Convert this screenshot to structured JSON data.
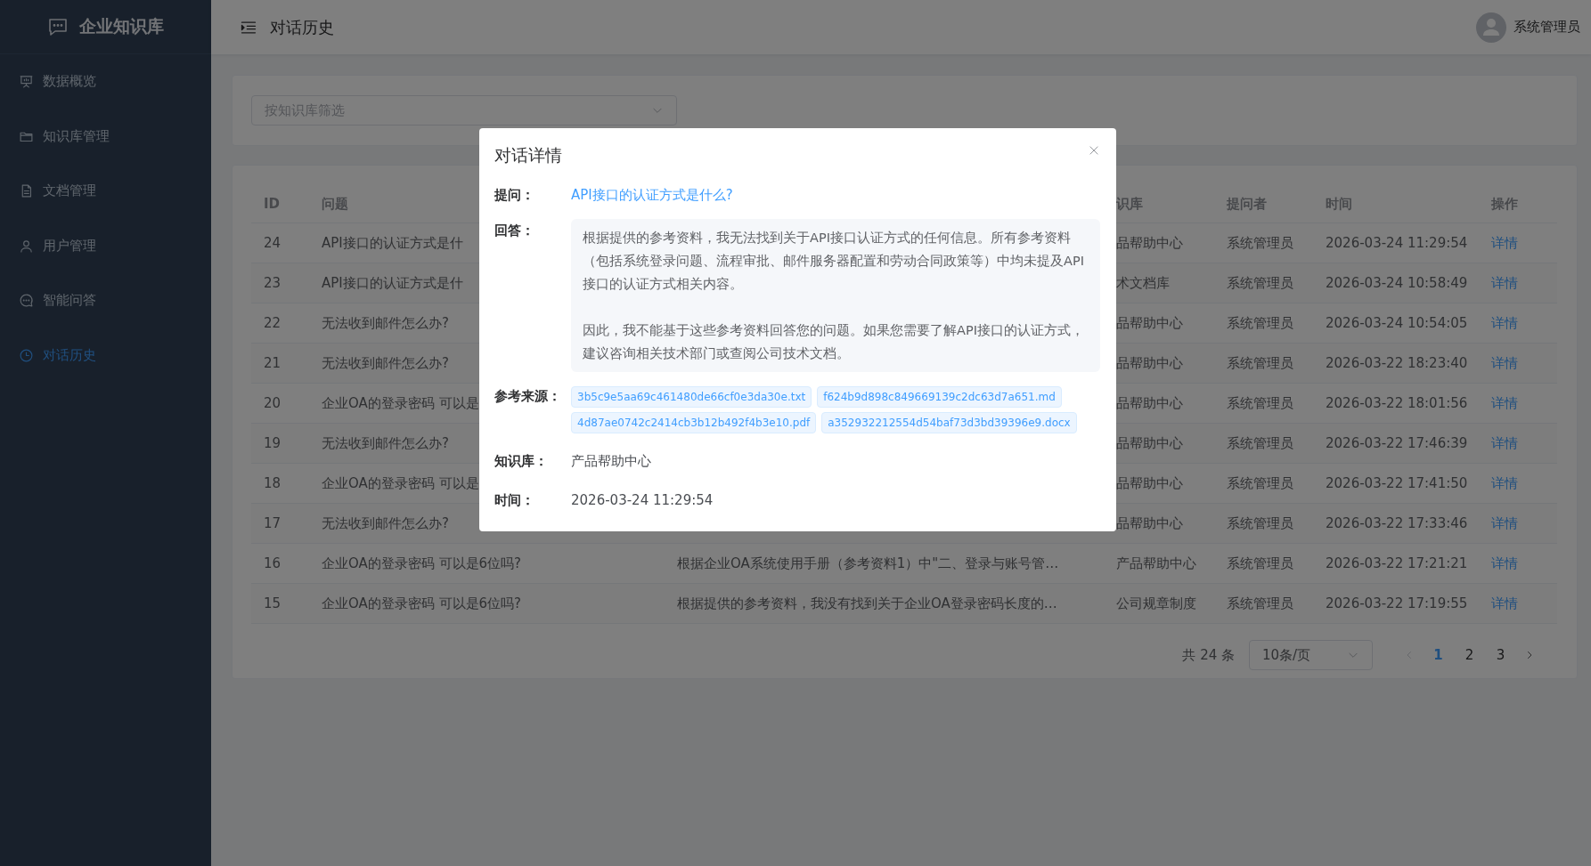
{
  "sidebar": {
    "logo": "企业知识库",
    "items": [
      {
        "label": "数据概览",
        "selected": false
      },
      {
        "label": "知识库管理",
        "selected": false
      },
      {
        "label": "文档管理",
        "selected": false
      },
      {
        "label": "用户管理",
        "selected": false
      },
      {
        "label": "智能问答",
        "selected": false
      },
      {
        "label": "对话历史",
        "selected": true
      }
    ]
  },
  "header": {
    "title": "对话历史",
    "user": "系统管理员"
  },
  "filter": {
    "placeholder": "按知识库筛选"
  },
  "table": {
    "columns": {
      "id": "ID",
      "question": "问题",
      "knowledge_base": "识库",
      "asker": "提问者",
      "time": "时间",
      "action": "操作"
    },
    "rows": [
      {
        "id": "24",
        "question": "API接口的认证方式是什",
        "knowledge_base": "品帮助中心",
        "asker": "系统管理员",
        "time": "2026-03-24 11:29:54",
        "action": "详情"
      },
      {
        "id": "23",
        "question": "API接口的认证方式是什",
        "knowledge_base": "术文档库",
        "asker": "系统管理员",
        "time": "2026-03-24 10:58:49",
        "action": "详情"
      },
      {
        "id": "22",
        "question": "无法收到邮件怎么办?",
        "knowledge_base": "品帮助中心",
        "asker": "系统管理员",
        "time": "2026-03-24 10:54:05",
        "action": "详情"
      },
      {
        "id": "21",
        "question": "无法收到邮件怎么办?",
        "knowledge_base": "品帮助中心",
        "asker": "系统管理员",
        "time": "2026-03-22 18:23:40",
        "action": "详情"
      },
      {
        "id": "20",
        "question": "企业OA的登录密码 可以是",
        "knowledge_base": "品帮助中心",
        "asker": "系统管理员",
        "time": "2026-03-22 18:01:56",
        "action": "详情"
      },
      {
        "id": "19",
        "question": "无法收到邮件怎么办?",
        "knowledge_base": "品帮助中心",
        "asker": "系统管理员",
        "time": "2026-03-22 17:46:39",
        "action": "详情"
      },
      {
        "id": "18",
        "question": "企业OA的登录密码 可以是",
        "knowledge_base": "品帮助中心",
        "asker": "系统管理员",
        "time": "2026-03-22 17:41:50",
        "action": "详情"
      },
      {
        "id": "17",
        "question": "无法收到邮件怎么办?",
        "knowledge_base": "品帮助中心",
        "asker": "系统管理员",
        "time": "2026-03-22 17:33:46",
        "action": "详情"
      },
      {
        "id": "16",
        "question": "企业OA的登录密码 可以是6位吗?",
        "answer": "根据企业OA系统使用手册（参考资料1）中\"二、登录与账号管…",
        "knowledge_base": "产品帮助中心",
        "asker": "系统管理员",
        "time": "2026-03-22 17:21:21",
        "action": "详情"
      },
      {
        "id": "15",
        "question": "企业OA的登录密码 可以是6位吗?",
        "answer": "根据提供的参考资料，我没有找到关于企业OA登录密码长度的…",
        "knowledge_base": "公司规章制度",
        "asker": "系统管理员",
        "time": "2026-03-22 17:19:55",
        "action": "详情"
      }
    ]
  },
  "pagination": {
    "total": "共 24 条",
    "page_size": "10条/页",
    "pages": [
      {
        "label": "1",
        "selected": true
      },
      {
        "label": "2",
        "selected": false
      },
      {
        "label": "3",
        "selected": false
      }
    ]
  },
  "dialog": {
    "title": "对话详情",
    "fields": [
      {
        "kind": "link",
        "label": "提问：",
        "value": "API接口的认证方式是什么?"
      },
      {
        "kind": "answer",
        "label": "回答：",
        "paragraphs": [
          "根据提供的参考资料，我无法找到关于API接口认证方式的任何信息。所有参考资料（包括系统登录问题、流程审批、邮件服务器配置和劳动合同政策等）中均未提及API接口的认证方式相关内容。",
          "因此，我不能基于这些参考资料回答您的问题。如果您需要了解API接口的认证方式，建议咨询相关技术部门或查阅公司技术文档。"
        ]
      },
      {
        "kind": "tags",
        "label": "参考来源：",
        "tags": [
          "3b5c9e5aa69c461480de66cf0e3da30e.txt",
          "f624b9d898c849669139c2dc63d7a651.md",
          "4d87ae0742c2414cb3b12b492f4b3e10.pdf",
          "a352932212554d54baf73d3bd39396e9.docx"
        ]
      },
      {
        "kind": "text",
        "label": "知识库：",
        "value": "产品帮助中心"
      },
      {
        "kind": "text",
        "label": "时间：",
        "value": "2026-03-24 11:29:54"
      }
    ]
  }
}
